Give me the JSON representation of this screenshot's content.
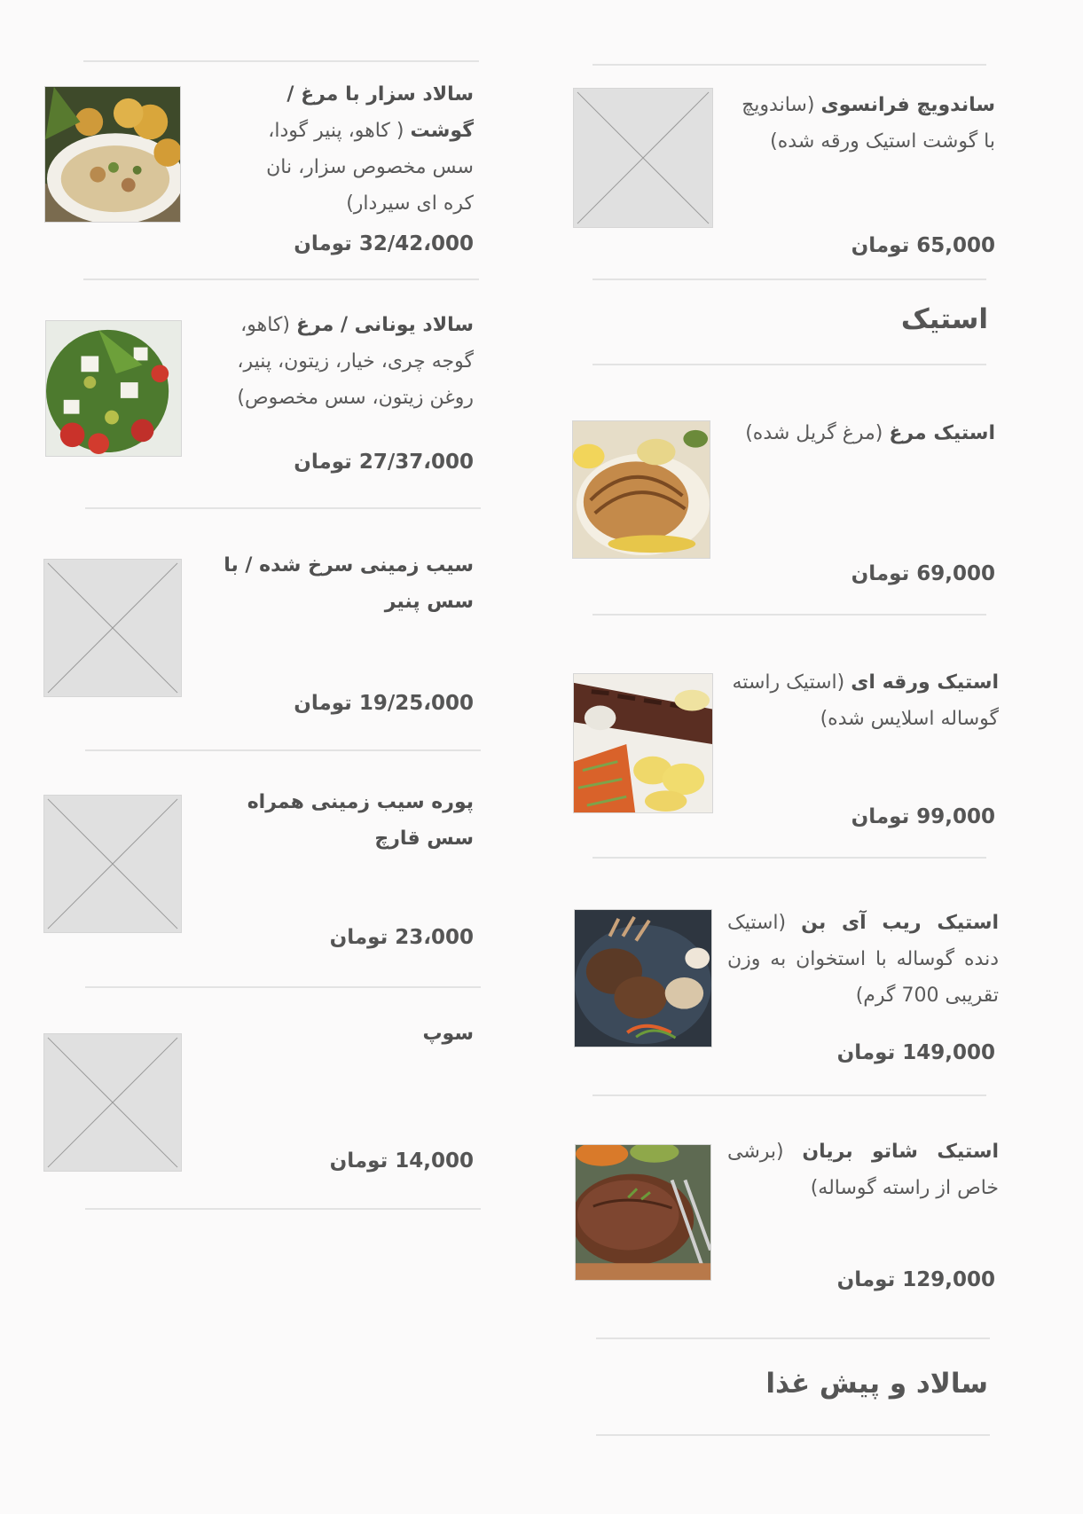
{
  "right_column": {
    "items": [
      {
        "name": "ساندویچ فرانسوی",
        "detail": "(ساندویچ با گوشت استیک ورقه شده)",
        "price": "65,000 تومان",
        "image": "placeholder"
      },
      {
        "name": "استیک مرغ",
        "detail": "(مرغ گریل شده)",
        "price": "69,000 تومان",
        "image": "photo"
      },
      {
        "name": "استیک ورقه ای",
        "detail": "(استیک راسته گوساله اسلایس شده)",
        "price": "99,000 تومان",
        "image": "photo"
      },
      {
        "name": "استیک ریب آی بن",
        "detail": "(استیک دنده گوساله با استخوان به وزن تقریبی 700 گرم)",
        "price": "149,000 تومان",
        "image": "photo"
      },
      {
        "name": "استیک شاتو بریان",
        "detail": "(برشی خاص از راسته گوساله)",
        "price": "129,000 تومان",
        "image": "photo"
      }
    ],
    "headings": {
      "steak": "استیک",
      "salad": "سالاد و پیش غذا"
    }
  },
  "left_column": {
    "items": [
      {
        "name": "سالاد سزار با مرغ / گوشت",
        "detail": "( کاهو، پنیر گودا، سس مخصوص سزار، نان کره ای سیردار)",
        "price": "32/42،000 تومان",
        "image": "photo"
      },
      {
        "name": "سالاد یونانی / مرغ",
        "detail": "(کاهو، گوجه چری، خیار، زیتون، پنیر، روغن زیتون، سس مخصوص)",
        "price": "27/37،000 تومان",
        "image": "photo"
      },
      {
        "name": "سیب زمینی سرخ شده / با سس پنیر",
        "detail": "",
        "price": "19/25،000 تومان",
        "image": "placeholder"
      },
      {
        "name": "پوره سیب زمینی همراه سس قارچ",
        "detail": "",
        "price": "23،000 تومان",
        "image": "placeholder"
      },
      {
        "name": "سوپ",
        "detail": "",
        "price": "14,000 تومان",
        "image": "placeholder"
      }
    ]
  }
}
